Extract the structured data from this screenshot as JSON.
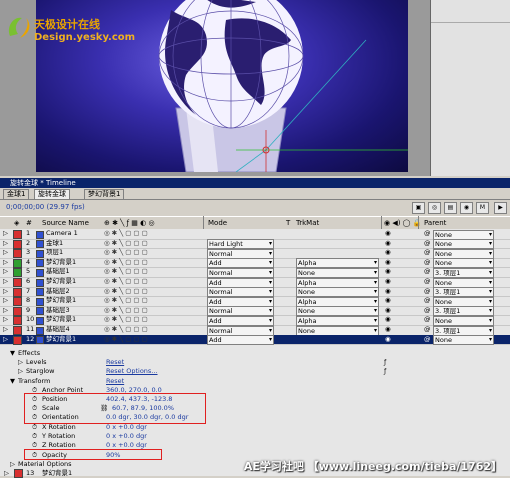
{
  "watermark": {
    "cn": "天极设计在线",
    "en": "Design.yesky.com"
  },
  "timeline": {
    "title": "旋转金球 * Timeline",
    "tabs": [
      "金球1",
      "旋转金球",
      "梦幻背景1"
    ],
    "timecode": "0;00;00;00",
    "fps": "(29.97 fps)"
  },
  "columns": {
    "source": "Source Name",
    "mode": "Mode",
    "t": "T",
    "trkmat": "TrkMat",
    "parent": "Parent"
  },
  "layers": [
    {
      "num": "1",
      "color": "#d83030",
      "name": "Camera 1",
      "mode": "",
      "trk": "",
      "parent": "None"
    },
    {
      "num": "2",
      "color": "#d83030",
      "name": "金球1",
      "mode": "Hard Light",
      "trk": "",
      "parent": "None"
    },
    {
      "num": "3",
      "color": "#d83030",
      "name": "项层1",
      "mode": "Normal",
      "trk": "",
      "parent": "None"
    },
    {
      "num": "4",
      "color": "#30a030",
      "name": "梦幻背景1",
      "mode": "Add",
      "trk": "Alpha",
      "parent": "None"
    },
    {
      "num": "5",
      "color": "#30a030",
      "name": "基础层1",
      "mode": "Normal",
      "trk": "None",
      "parent": "3. 项层1"
    },
    {
      "num": "6",
      "color": "#d83030",
      "name": "梦幻背景1",
      "mode": "Add",
      "trk": "Alpha",
      "parent": "None"
    },
    {
      "num": "7",
      "color": "#d83030",
      "name": "基础层2",
      "mode": "Normal",
      "trk": "None",
      "parent": "3. 项层1"
    },
    {
      "num": "8",
      "color": "#d83030",
      "name": "梦幻背景1",
      "mode": "Add",
      "trk": "Alpha",
      "parent": "None"
    },
    {
      "num": "9",
      "color": "#d83030",
      "name": "基础层3",
      "mode": "Normal",
      "trk": "None",
      "parent": "3. 项层1"
    },
    {
      "num": "10",
      "color": "#d83030",
      "name": "梦幻背景1",
      "mode": "Add",
      "trk": "Alpha",
      "parent": "None"
    },
    {
      "num": "11",
      "color": "#d83030",
      "name": "基础层4",
      "mode": "Normal",
      "trk": "None",
      "parent": "3. 项层1"
    },
    {
      "num": "12",
      "color": "#d83030",
      "name": "梦幻背景1",
      "mode": "Add",
      "trk": "",
      "parent": "None"
    }
  ],
  "properties": {
    "effects": "Effects",
    "levels": "Levels",
    "levels_reset": "Reset",
    "starglow": "Starglow",
    "starglow_reset": "Reset Options...",
    "transform": "Transform",
    "transform_reset": "Reset",
    "anchor": "Anchor Point",
    "anchor_val": "360.0, 270.0, 0.0",
    "position": "Position",
    "position_val": "402.4, 437.3, -123.8",
    "scale": "Scale",
    "scale_val": "60.7, 87.9, 100.0%",
    "orientation": "Orientation",
    "orientation_val": "0.0 dgr, 30.0 dgr, 0.0 dgr",
    "xrot": "X Rotation",
    "xrot_val": "0 x +0.0 dgr",
    "yrot": "Y Rotation",
    "yrot_val": "0 x +0.0 dgr",
    "zrot": "Z Rotation",
    "zrot_val": "0 x +0.0 dgr",
    "opacity": "Opacity",
    "opacity_val": "90%",
    "material": "Material Options",
    "layer13": "13",
    "layer13_name": "梦幻背景1"
  },
  "credit": "AE学习社吧 【www.lineeg.com/tieba/1762】",
  "colors": {
    "selection": "#0a246a",
    "value_blue": "#1a3aa0",
    "highlight_box": "#e02020"
  }
}
